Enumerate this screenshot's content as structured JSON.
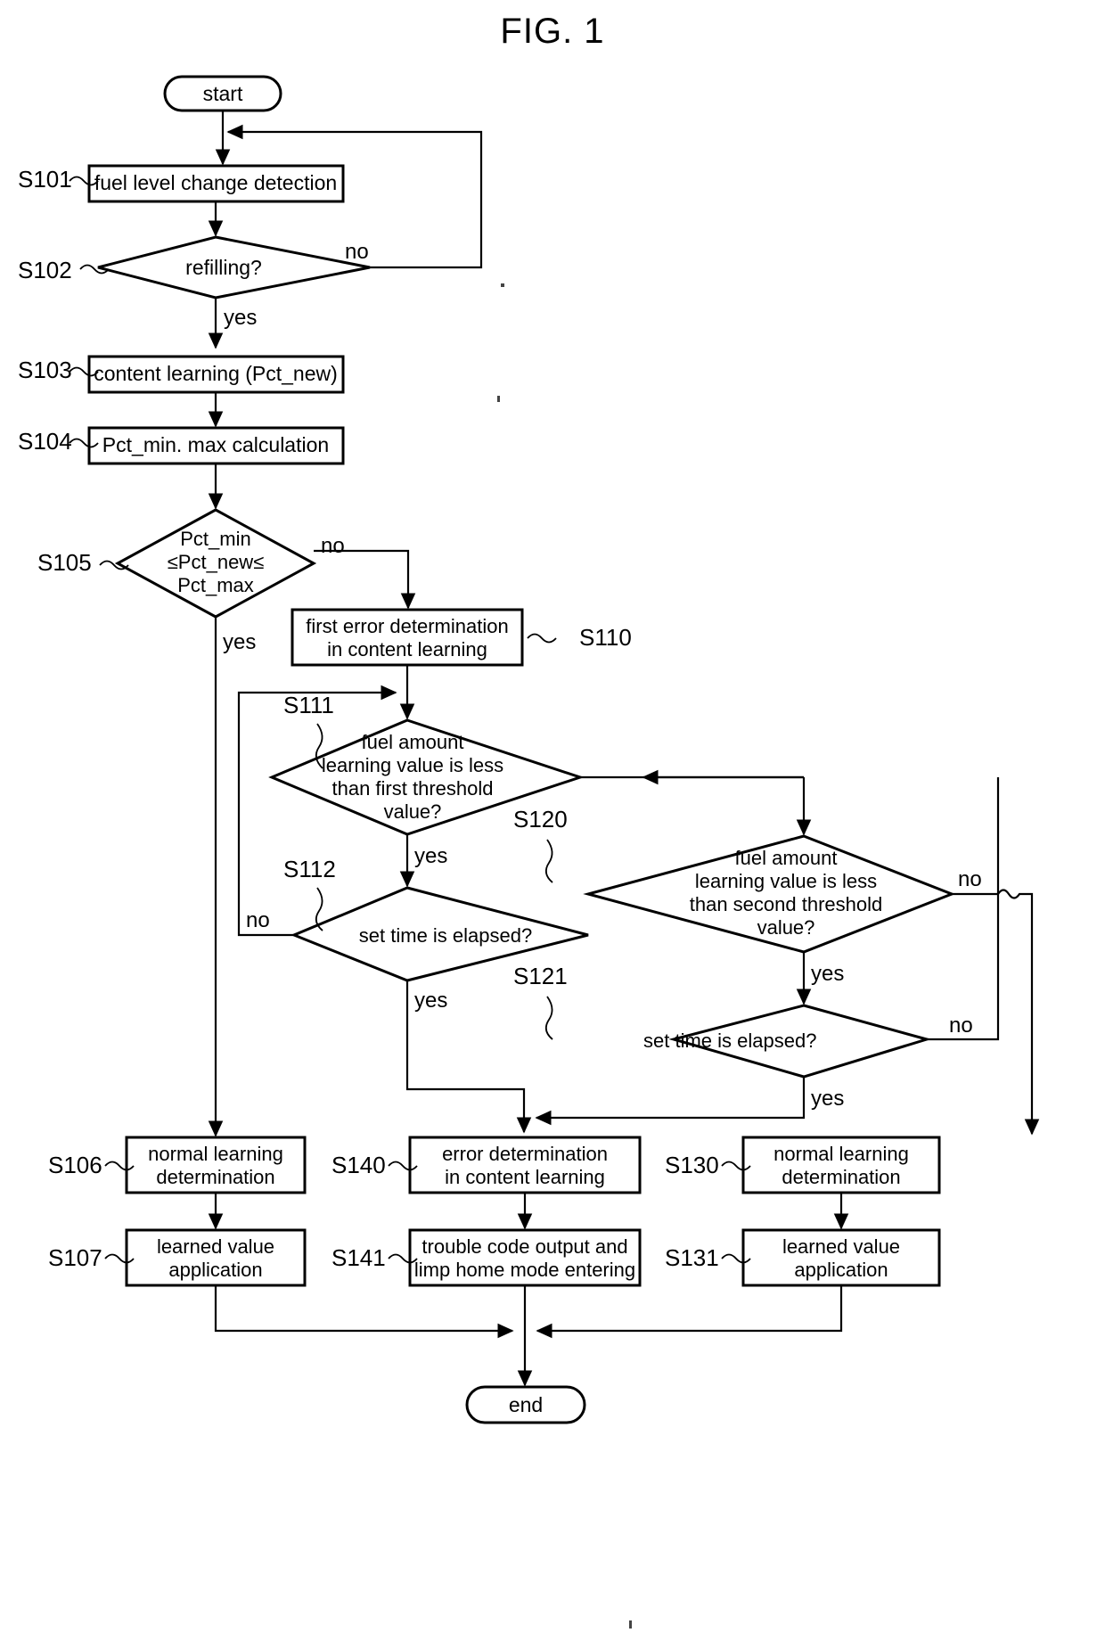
{
  "figure": {
    "title": "FIG. 1",
    "type": "flowchart"
  },
  "terminals": {
    "start": "start",
    "end": "end"
  },
  "steps": [
    {
      "id": "S101",
      "tag": "S101",
      "shape": "process",
      "lines": [
        "fuel level change detection"
      ]
    },
    {
      "id": "S102",
      "tag": "S102",
      "shape": "decision",
      "lines": [
        "refilling?"
      ]
    },
    {
      "id": "S103",
      "tag": "S103",
      "shape": "process",
      "lines": [
        "content learning (Pct_new)"
      ]
    },
    {
      "id": "S104",
      "tag": "S104",
      "shape": "process",
      "lines": [
        "Pct_min. max calculation"
      ]
    },
    {
      "id": "S105",
      "tag": "S105",
      "shape": "decision",
      "lines": [
        "Pct_min",
        "≤Pct_new≤",
        "Pct_max"
      ]
    },
    {
      "id": "S110",
      "tag": "S110",
      "shape": "process",
      "lines": [
        "first error determination",
        "in content learning"
      ]
    },
    {
      "id": "S111",
      "tag": "S111",
      "shape": "decision",
      "lines": [
        "fuel amount",
        "learning value is less",
        "than first threshold",
        "value?"
      ]
    },
    {
      "id": "S112",
      "tag": "S112",
      "shape": "decision",
      "lines": [
        "set time is elapsed?"
      ]
    },
    {
      "id": "S120",
      "tag": "S120",
      "shape": "decision",
      "lines": [
        "fuel amount",
        "learning value is less",
        "than second threshold",
        "value?"
      ]
    },
    {
      "id": "S121",
      "tag": "S121",
      "shape": "decision",
      "lines": [
        "set time is elapsed?"
      ]
    },
    {
      "id": "S106",
      "tag": "S106",
      "shape": "process",
      "lines": [
        "normal learning",
        "determination"
      ]
    },
    {
      "id": "S107",
      "tag": "S107",
      "shape": "process",
      "lines": [
        "learned value",
        "application"
      ]
    },
    {
      "id": "S140",
      "tag": "S140",
      "shape": "process",
      "lines": [
        "error determination",
        "in content learning"
      ]
    },
    {
      "id": "S141",
      "tag": "S141",
      "shape": "process",
      "lines": [
        "trouble code output and",
        "limp home mode entering"
      ]
    },
    {
      "id": "S130",
      "tag": "S130",
      "shape": "process",
      "lines": [
        "normal learning",
        "determination"
      ]
    },
    {
      "id": "S131",
      "tag": "S131",
      "shape": "process",
      "lines": [
        "learned value",
        "application"
      ]
    }
  ],
  "branch_labels": {
    "s102_no": "no",
    "s102_yes": "yes",
    "s105_no": "no",
    "s105_yes": "yes",
    "s111_yes": "yes",
    "s112_no": "no",
    "s112_yes": "yes",
    "s120_no": "no",
    "s120_yes": "yes",
    "s121_no": "no",
    "s121_yes": "yes"
  },
  "node_text": {
    "S101_l0": "fuel level change detection",
    "S102_l0": "refilling?",
    "S103_l0": "content learning (Pct_new)",
    "S104_l0": "Pct_min. max calculation",
    "S105_l0": "Pct_min",
    "S105_l1": "≤Pct_new≤",
    "S105_l2": "Pct_max",
    "S110_l0": "first error determination",
    "S110_l1": "in content learning",
    "S111_l0": "fuel amount",
    "S111_l1": "learning value is less",
    "S111_l2": "than first threshold",
    "S111_l3": "value?",
    "S112_l0": "set time is elapsed?",
    "S120_l0": "fuel amount",
    "S120_l1": "learning value is less",
    "S120_l2": "than second threshold",
    "S120_l3": "value?",
    "S121_l0": "set time is elapsed?",
    "S106_l0": "normal learning",
    "S106_l1": "determination",
    "S107_l0": "learned value",
    "S107_l1": "application",
    "S140_l0": "error determination",
    "S140_l1": "in content learning",
    "S141_l0": "trouble code output and",
    "S141_l1": "limp home mode entering",
    "S130_l0": "normal learning",
    "S130_l1": "determination",
    "S131_l0": "learned value",
    "S131_l1": "application"
  },
  "step_tags": {
    "S101": "S101",
    "S102": "S102",
    "S103": "S103",
    "S104": "S104",
    "S105": "S105",
    "S110": "S110",
    "S111": "S111",
    "S112": "S112",
    "S120": "S120",
    "S121": "S121",
    "S106": "S106",
    "S107": "S107",
    "S140": "S140",
    "S141": "S141",
    "S130": "S130",
    "S131": "S131"
  },
  "colors": {
    "ink": "#000000",
    "paper": "#ffffff"
  }
}
